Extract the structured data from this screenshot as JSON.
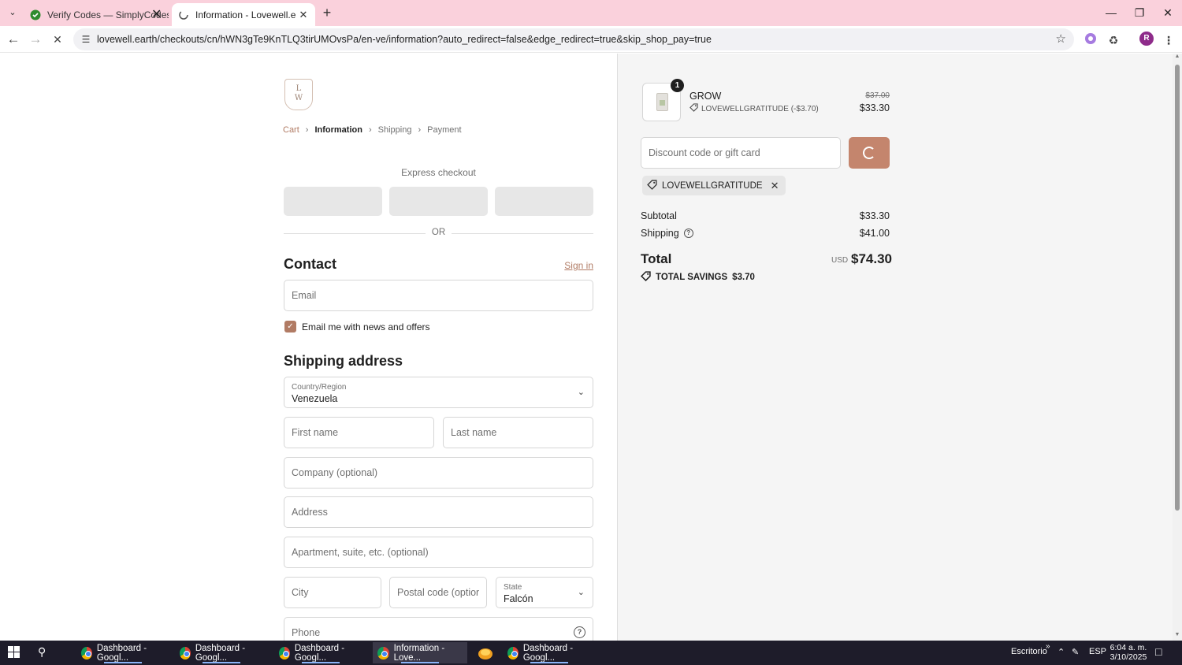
{
  "browser": {
    "tabs": [
      {
        "title": "Verify Codes — SimplyCodes",
        "active": false
      },
      {
        "title": "Information - Lovewell.earth - C",
        "active": true
      }
    ],
    "url": "lovewell.earth/checkouts/cn/hWN3gTe9KnTLQ3tirUMOvsPa/en-ve/information?auto_redirect=false&edge_redirect=true&skip_shop_pay=true",
    "profile_initial": "R"
  },
  "store": {
    "logo_text": "L\nW"
  },
  "breadcrumb": [
    "Cart",
    "Information",
    "Shipping",
    "Payment"
  ],
  "express": {
    "label": "Express checkout",
    "or": "OR"
  },
  "contact": {
    "heading": "Contact",
    "sign_in": "Sign in",
    "email_placeholder": "Email",
    "newsletter_label": "Email me with news and offers",
    "newsletter_checked": true
  },
  "shipping": {
    "heading": "Shipping address",
    "country_label": "Country/Region",
    "country_value": "Venezuela",
    "first_name_placeholder": "First name",
    "last_name_placeholder": "Last name",
    "company_placeholder": "Company (optional)",
    "address_placeholder": "Address",
    "apartment_placeholder": "Apartment, suite, etc. (optional)",
    "city_placeholder": "City",
    "postal_placeholder": "Postal code (optional)",
    "state_label": "State",
    "state_value": "Falcón",
    "phone_placeholder": "Phone"
  },
  "summary": {
    "item": {
      "quantity": "1",
      "name": "GROW",
      "discount": "LOVEWELLGRATITUDE (-$3.70)",
      "price_original": "$37.00",
      "price": "$33.30"
    },
    "discount_placeholder": "Discount code or gift card",
    "applied_code": "LOVEWELLGRATITUDE",
    "subtotal_label": "Subtotal",
    "subtotal": "$33.30",
    "shipping_label": "Shipping",
    "shipping": "$41.00",
    "total_label": "Total",
    "currency": "USD",
    "total": "$74.30",
    "savings_label": "TOTAL SAVINGS",
    "savings": "$3.70"
  },
  "taskbar": {
    "items": [
      "Dashboard - Googl...",
      "Dashboard - Googl...",
      "Dashboard - Googl...",
      "Information - Love...",
      "Dashboard - Googl..."
    ],
    "desktop_label": "Escritorio",
    "language": "ESP",
    "time": "6:04 a. m.",
    "date": "3/10/2025"
  },
  "colors": {
    "accent": "#b17b64",
    "button": "#c4856d",
    "tabbar": "#fad1dc"
  }
}
